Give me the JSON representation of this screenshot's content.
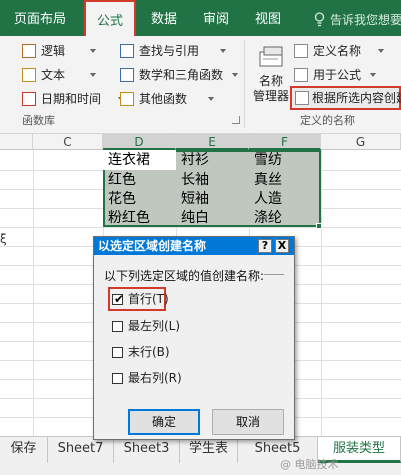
{
  "tabs": {
    "page_layout": "页面布局",
    "formulas": "公式",
    "data": "数据",
    "review": "审阅",
    "view": "视图",
    "tell_me": "告诉我您想要"
  },
  "ribbon": {
    "function_library": {
      "logical": "逻辑",
      "text": "文本",
      "date_time": "日期和时间",
      "lookup": "查找与引用",
      "math_trig": "数学和三角函数",
      "more": "其他函数",
      "group_label": "函数库"
    },
    "defined_names": {
      "name_manager": "名称\n管理器",
      "define_name": "定义名称",
      "use_in_formula": "用于公式",
      "create_from_selection": "根据所选内容创建",
      "group_label": "定义的名称"
    }
  },
  "sheet": {
    "columns": [
      "C",
      "D",
      "E",
      "F",
      "G"
    ],
    "cells": [
      [
        "连衣裙",
        "衬衫",
        "雪纺"
      ],
      [
        "红色",
        "长袖",
        "真丝"
      ],
      [
        "花色",
        "短袖",
        "人造"
      ],
      [
        "粉红色",
        "纯白",
        "涤纶"
      ]
    ],
    "left_fragment": "ξ"
  },
  "dialog": {
    "title": "以选定区域创建名称",
    "help": "?",
    "close": "X",
    "prompt": "以下列选定区域的值创建名称:",
    "options": [
      {
        "label": "首行(T)",
        "checked": true
      },
      {
        "label": "最左列(L)",
        "checked": false
      },
      {
        "label": "末行(B)",
        "checked": false
      },
      {
        "label": "最右列(R)",
        "checked": false
      }
    ],
    "ok": "确定",
    "cancel": "取消"
  },
  "sheet_tabs": [
    "保存",
    "Sheet7",
    "Sheet3",
    "学生表",
    "Sheet5",
    "服装类型"
  ],
  "watermark": "@ 电脑技术"
}
